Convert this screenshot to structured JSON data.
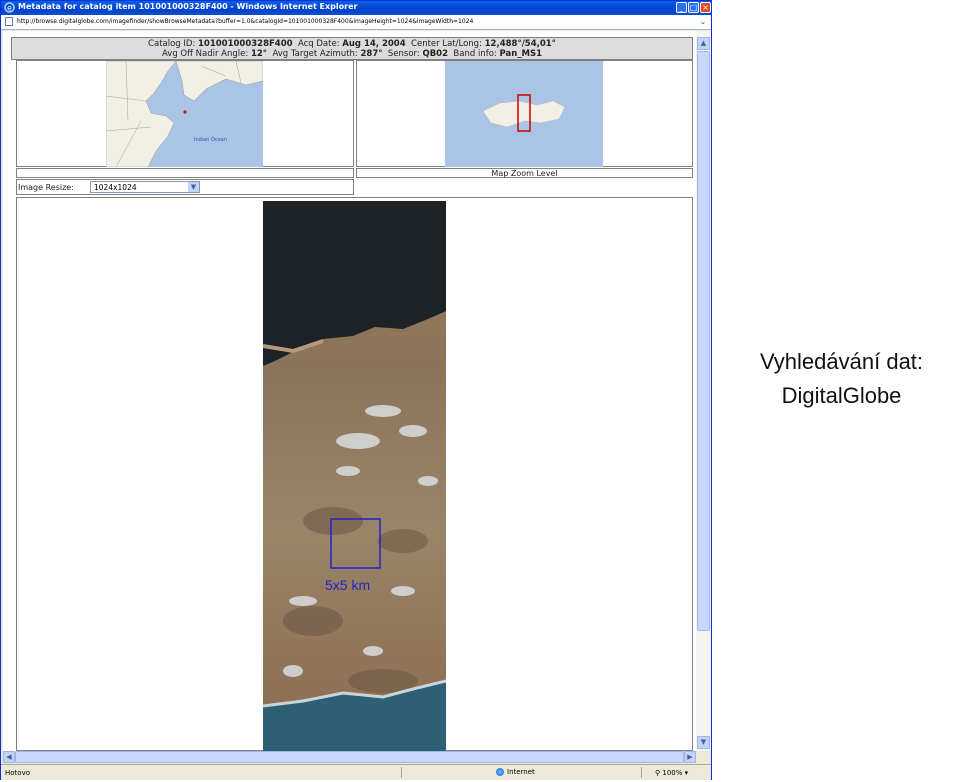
{
  "window": {
    "title": "Metadata for catalog item 101001000328F400 - Windows Internet Explorer",
    "address": "http://browse.digitalglobe.com/imagefinder/showBrowseMetadata?buffer=1.0&catalogId=101001000328F400&imageHeight=1024&imageWidth=1024"
  },
  "metadata": {
    "catalog_id_label": "Catalog ID:",
    "catalog_id": "101001000328F400",
    "acq_date_label": "Acq Date:",
    "acq_date": "Aug 14, 2004",
    "center_label": "Center Lat/Long:",
    "center": "12,488°/54,01°",
    "nadir_label": "Avg Off Nadir Angle:",
    "nadir": "12°",
    "azimuth_label": "Avg Target Azimuth:",
    "azimuth": "287°",
    "sensor_label": "Sensor:",
    "sensor": "QB02",
    "band_label": "Band info:",
    "band": "Pan_MS1"
  },
  "maps": {
    "overview_ocean_label": "Indian Ocean",
    "zoom_label": "Map Zoom Level"
  },
  "resize": {
    "label": "Image Resize:",
    "value": "1024x1024"
  },
  "image": {
    "scale_label": "5x5 km"
  },
  "status": {
    "left": "Hotovo",
    "zone": "Internet",
    "zoom": "100%"
  },
  "caption": {
    "line1": "Vyhledávání dat:",
    "line2": "DigitalGlobe"
  },
  "colors": {
    "titlebar": "#0a5fe8",
    "zoom_box": "#cc0000",
    "scale_box": "#2222cc"
  }
}
